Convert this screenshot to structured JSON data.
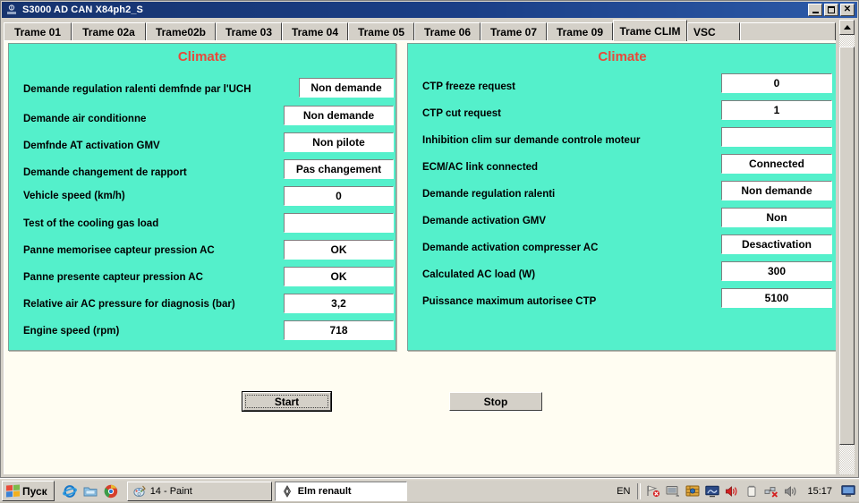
{
  "window": {
    "title": "S3000 AD CAN X84ph2_S",
    "icon": "app-icon",
    "controls": {
      "minimize": "minimize-button",
      "maximize": "maximize-button",
      "close": "close-button"
    }
  },
  "tabs": {
    "items": [
      {
        "label": "Trame 01",
        "active": false
      },
      {
        "label": "Trame 02a",
        "active": false
      },
      {
        "label": "Trame02b",
        "active": false
      },
      {
        "label": "Trame 03",
        "active": false
      },
      {
        "label": "Trame 04",
        "active": false
      },
      {
        "label": "Trame 05",
        "active": false
      },
      {
        "label": "Trame 06",
        "active": false
      },
      {
        "label": "Trame 07",
        "active": false
      },
      {
        "label": "Trame 09",
        "active": false
      },
      {
        "label": "Trame CLIM",
        "active": true
      },
      {
        "label": "VSC",
        "active": false
      }
    ]
  },
  "panels": {
    "left": {
      "title": "Climate",
      "rows": [
        {
          "label": "Demande regulation ralenti demfnde par l'UCH",
          "value": "Non demande"
        },
        {
          "label": "Demande air conditionne",
          "value": "Non demande"
        },
        {
          "label": "Demfnde AT activation GMV",
          "value": "Non pilote"
        },
        {
          "label": "Demande changement de rapport",
          "value": "Pas changement"
        },
        {
          "label": "Vehicle speed (km/h)",
          "value": "0"
        },
        {
          "label": "Test of the cooling gas load",
          "value": ""
        },
        {
          "label": "Panne memorisee capteur pression AC",
          "value": "OK"
        },
        {
          "label": "Panne presente capteur pression AC",
          "value": "OK"
        },
        {
          "label": "Relative air AC pressure for diagnosis (bar)",
          "value": "3,2"
        },
        {
          "label": "Engine speed (rpm)",
          "value": "718"
        }
      ]
    },
    "right": {
      "title": "Climate",
      "rows": [
        {
          "label": "CTP freeze request",
          "value": "0"
        },
        {
          "label": "CTP cut request",
          "value": "1"
        },
        {
          "label": "Inhibition clim sur demande controle moteur",
          "value": ""
        },
        {
          "label": "ECM/AC link connected",
          "value": "Connected"
        },
        {
          "label": "Demande regulation ralenti",
          "value": "Non demande"
        },
        {
          "label": "Demande activation GMV",
          "value": "Non"
        },
        {
          "label": "Demande activation compresser AC",
          "value": "Desactivation"
        },
        {
          "label": "Calculated AC load (W)",
          "value": "300"
        },
        {
          "label": "Puissance maximum autorisee CTP",
          "value": "5100"
        }
      ]
    }
  },
  "buttons": {
    "start": "Start",
    "stop": "Stop"
  },
  "scrollbar": {
    "up_arrow": "scroll-up-arrow"
  },
  "taskbar": {
    "start_label": "Пуск",
    "quick_launch": [
      {
        "name": "internet-explorer-icon"
      },
      {
        "name": "folder-icon"
      },
      {
        "name": "chrome-icon"
      }
    ],
    "tasks": [
      {
        "label": "14 - Paint",
        "icon": "paint-icon",
        "active": false
      },
      {
        "label": "Elm renault",
        "icon": "renault-icon",
        "active": true
      }
    ],
    "tray": {
      "language": "EN",
      "icons": [
        {
          "name": "network-disconnected-icon"
        },
        {
          "name": "monitor-icon"
        },
        {
          "name": "firewall-icon"
        },
        {
          "name": "display-adapter-icon"
        },
        {
          "name": "volume-icon"
        },
        {
          "name": "battery-icon"
        },
        {
          "name": "network-error-icon"
        },
        {
          "name": "speaker-icon"
        }
      ],
      "clock": "15:17",
      "show_desktop": "show-desktop-icon"
    }
  },
  "colors": {
    "panel_bg": "#54F0CB",
    "panel_title": "#E8483A",
    "form_bg": "#FFFDF2",
    "chrome": "#D4D0C8",
    "titlebar": "#1B3F87"
  }
}
